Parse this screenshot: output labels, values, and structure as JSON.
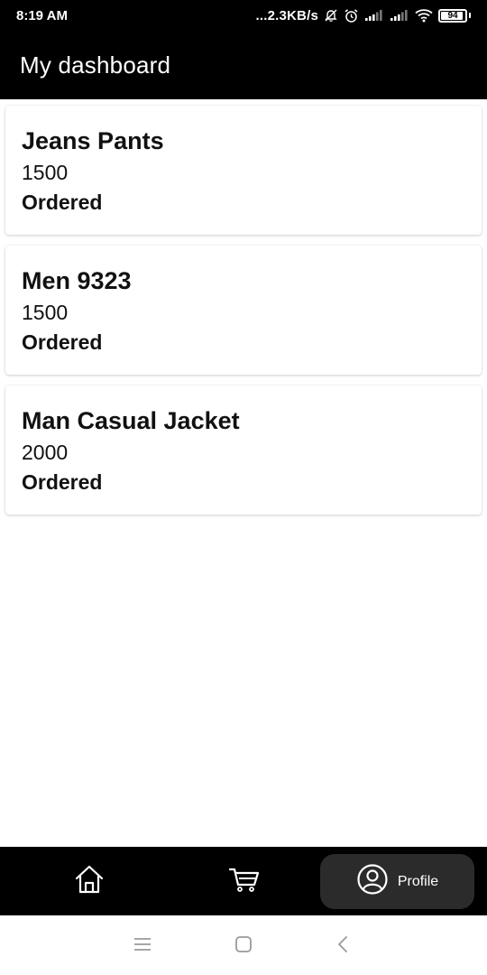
{
  "status_bar": {
    "time": "8:19 AM",
    "network_speed": "...2.3KB/s",
    "battery_level": "94",
    "battery_fraction": 0.94,
    "icons": [
      "notifications-off-icon",
      "alarm-icon",
      "signal-icon",
      "signal-icon",
      "wifi-icon",
      "battery-icon"
    ]
  },
  "app_bar": {
    "title": "My dashboard"
  },
  "orders": [
    {
      "name": "Jeans Pants",
      "price": "1500",
      "status": "Ordered"
    },
    {
      "name": "Men 9323",
      "price": "1500",
      "status": "Ordered"
    },
    {
      "name": "Man Casual Jacket",
      "price": "2000",
      "status": "Ordered"
    }
  ],
  "bottom_nav": {
    "items": [
      {
        "icon": "home-icon"
      },
      {
        "icon": "cart-icon"
      },
      {
        "icon": "profile-icon",
        "label": "Profile",
        "active": true
      }
    ]
  },
  "system_nav": {
    "icons": [
      "menu-icon",
      "home-square-icon",
      "back-icon"
    ]
  },
  "colors": {
    "app_bar": "#000000",
    "active_pill": "#2b2b2b",
    "card_bg": "#ffffff"
  }
}
